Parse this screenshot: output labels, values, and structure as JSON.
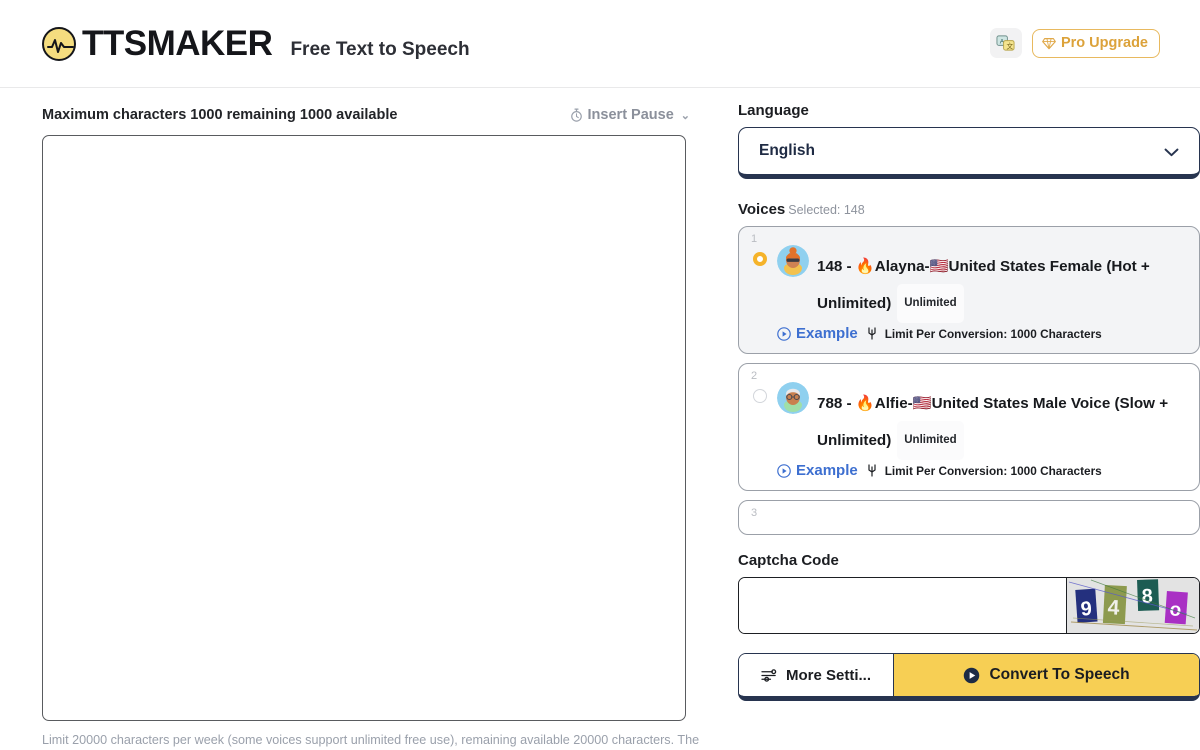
{
  "header": {
    "brand_name": "TTSMAKER",
    "tagline": "Free Text to Speech",
    "logo_icon": "waveform-circle-icon",
    "language_icon": "translate-icon",
    "pro_upgrade_label": "Pro Upgrade",
    "pro_upgrade_icon": "diamond-icon",
    "accent_color": "#dca23a"
  },
  "editor": {
    "char_info": "Maximum characters 1000 remaining 1000 available",
    "insert_pause_label": "Insert Pause",
    "insert_pause_icon": "stopwatch-icon",
    "insert_pause_chevron": "chevron-down-icon",
    "text_value": "",
    "text_placeholder": "",
    "bottom_note": "Limit 20000 characters per week (some voices support unlimited free use), remaining available 20000 characters. The"
  },
  "language": {
    "label": "Language",
    "selected": "English",
    "chevron_icon": "chevron-down-icon"
  },
  "voices": {
    "label": "Voices",
    "selected_note": "Selected: 148",
    "items": [
      {
        "index": "1",
        "selected": true,
        "avatar_icon": "woman-avatar-icon",
        "title": "148 - 🔥Alayna-🇺🇸United States Female (Hot + Unlimited)",
        "badge": "Unlimited",
        "example_label": "Example",
        "example_icon": "play-circle-icon",
        "limit_icon": "limit-icon",
        "limit_text": "Limit Per Conversion: 1000 Characters"
      },
      {
        "index": "2",
        "selected": false,
        "avatar_icon": "man-avatar-icon",
        "title": "788 - 🔥Alfie-🇺🇸United States Male Voice (Slow + Unlimited)",
        "badge": "Unlimited",
        "example_label": "Example",
        "example_icon": "play-circle-icon",
        "limit_icon": "limit-icon",
        "limit_text": "Limit Per Conversion: 1000 Characters"
      },
      {
        "index": "3",
        "selected": false,
        "avatar_icon": "",
        "title": "",
        "badge": "",
        "example_label": "",
        "example_icon": "",
        "limit_icon": "",
        "limit_text": ""
      }
    ]
  },
  "captcha": {
    "label": "Captcha Code",
    "value": "",
    "placeholder": "",
    "image_characters": [
      "9",
      "4",
      "8",
      "o"
    ],
    "image_colors": [
      "#24307e",
      "#8d9a4e",
      "#1d5c53",
      "#a930c4"
    ]
  },
  "actions": {
    "more_settings_label": "More Setti...",
    "more_settings_icon": "sliders-icon",
    "convert_label": "Convert To Speech",
    "convert_icon": "play-circle-icon",
    "convert_color": "#f7cf54"
  }
}
